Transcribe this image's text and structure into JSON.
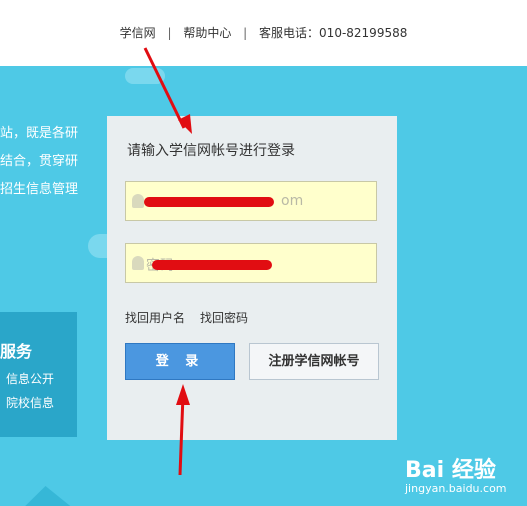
{
  "header": {
    "links": [
      "学信网",
      "帮助中心",
      "客服电话：010-82199588"
    ],
    "separator": "|"
  },
  "intro": {
    "lines": [
      "站，既是各研",
      "结合，贯穿研",
      "招生信息管理"
    ]
  },
  "services": {
    "title": "服务",
    "items": [
      "信息公开",
      "院校信息"
    ]
  },
  "login": {
    "heading": "请输入学信网帐号进行登录",
    "username_placeholder_fragment": "om",
    "password_placeholder_fragment": "密码",
    "links": [
      "找回用户名",
      "找回密码"
    ],
    "login_button": "登 录",
    "register_button": "注册学信网帐号"
  },
  "watermark": {
    "brand": "Bai  经验",
    "url": "jingyan.baidu.com"
  },
  "colors": {
    "background": "#4ec9e6",
    "primary_button": "#4b97e0",
    "input_fill": "#ffffcc",
    "annotation_red": "#e10d12"
  }
}
